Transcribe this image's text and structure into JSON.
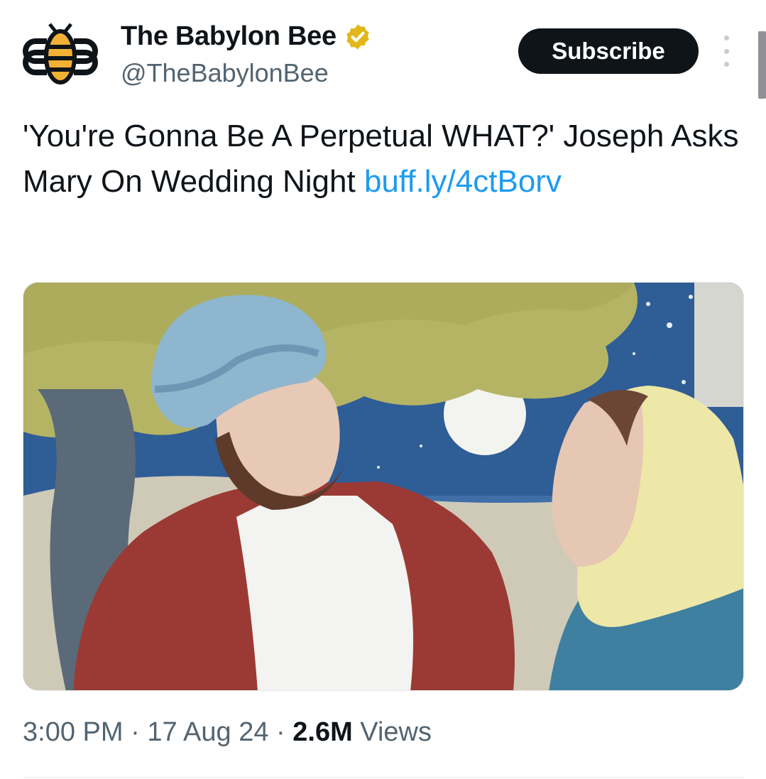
{
  "author": {
    "display_name": "The Babylon Bee",
    "handle": "@TheBabylonBee",
    "avatar_icon": "bee-logo-icon",
    "verified_icon": "verified-badge-icon",
    "verified_color": "#e2b719"
  },
  "actions": {
    "subscribe_label": "Subscribe",
    "more_icon": "more-options-icon"
  },
  "tweet": {
    "text": "'You're Gonna Be A Perpetual WHAT?' Joseph Asks Mary On Wedding Night ",
    "link": "buff.ly/4ctBorv",
    "link_color": "#1d9bf0"
  },
  "media": {
    "kind": "illustration"
  },
  "meta": {
    "time": "3:00 PM",
    "sep1": " · ",
    "date": "17 Aug 24",
    "sep2": " · ",
    "views_count": "2.6M",
    "views_label": " Views"
  }
}
